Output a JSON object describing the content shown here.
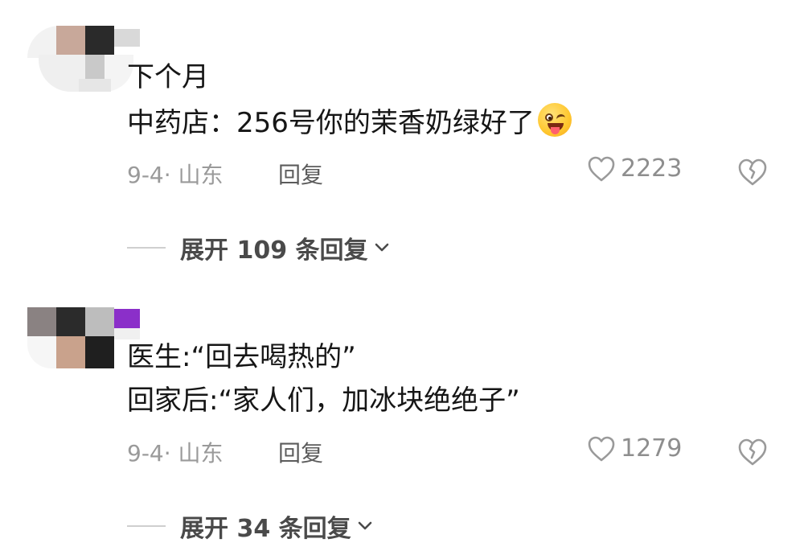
{
  "comments": [
    {
      "lines": [
        "下个月",
        "中药店：256号你的茉香奶绿好了"
      ],
      "emoji": "winking-tongue-emoji",
      "date_location": "9-4· 山东",
      "reply_label": "回复",
      "like_count": "2223",
      "expand_label": "展开 109 条回复"
    },
    {
      "lines": [
        "医生:“回去喝热的”",
        "回家后:“家人们，加冰块绝绝子”"
      ],
      "date_location": "9-4· 山东",
      "reply_label": "回复",
      "like_count": "1279",
      "expand_label": "展开 34 条回复"
    }
  ],
  "colors": {
    "text_primary": "#161616",
    "text_meta": "#9a9a9a",
    "text_reply": "#5c5c5c",
    "accent_purple": "#8b2fc9"
  },
  "icons": {
    "like": "heart-outline-icon",
    "dislike": "broken-heart-icon",
    "expand": "chevron-down-icon"
  }
}
